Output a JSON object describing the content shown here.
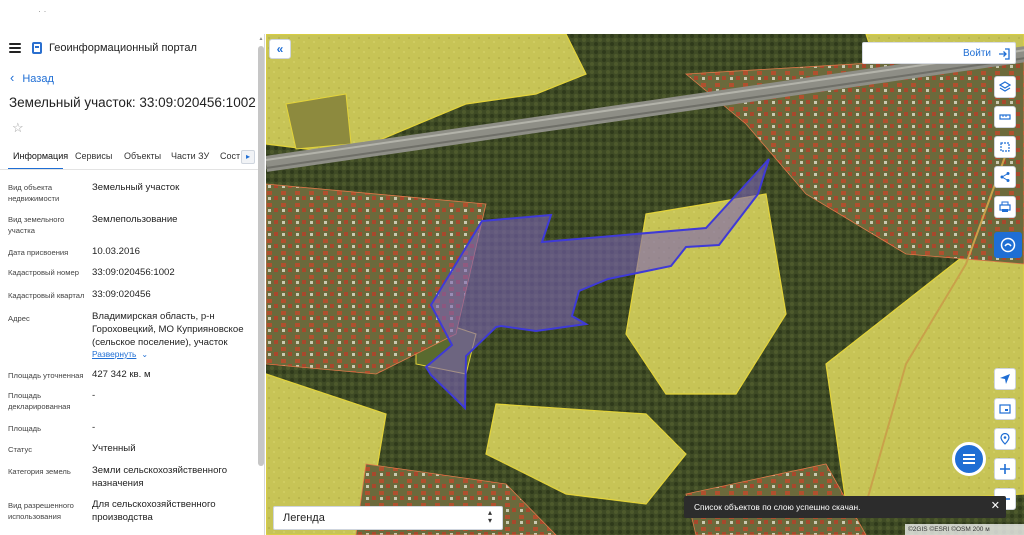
{
  "header": {
    "portal_title": "Геоинформационный портал"
  },
  "nav": {
    "back_label": "Назад"
  },
  "parcel": {
    "title": "Земельный участок: 33:09:020456:1002"
  },
  "tabs": [
    {
      "label": "Информация"
    },
    {
      "label": "Сервисы"
    },
    {
      "label": "Объекты"
    },
    {
      "label": "Части ЗУ"
    },
    {
      "label": "Сост"
    }
  ],
  "fields": [
    {
      "label": "Вид объекта недвижимости",
      "value": "Земельный участок"
    },
    {
      "label": "Вид земельного участка",
      "value": "Землепользование"
    },
    {
      "label": "Дата присвоения",
      "value": "10.03.2016"
    },
    {
      "label": "Кадастровый номер",
      "value": "33:09:020456:1002"
    },
    {
      "label": "Кадастровый квартал",
      "value": "33:09:020456"
    },
    {
      "label": "Адрес",
      "value": "Владимирская область, р-н Гороховецкий, МО Куприяновское (сельское поселение), участок"
    },
    {
      "label": "Площадь уточненная",
      "value": "427 342 кв. м"
    },
    {
      "label": "Площадь декларированная",
      "value": "-"
    },
    {
      "label": "Площадь",
      "value": "-"
    },
    {
      "label": "Статус",
      "value": "Учтенный"
    },
    {
      "label": "Категория земель",
      "value": "Земли сельскохозяйственного назначения"
    },
    {
      "label": "Вид разрешенного использования",
      "value": "Для сельскохозяйственного производства"
    }
  ],
  "address_expand_label": "Развернуть",
  "map": {
    "login_label": "Войти",
    "legend_label": "Легенда",
    "toast_message": "Список объектов по слою успешно скачан.",
    "attribution": "©2GIS ©ESRI ©OSM  200 м",
    "colors": {
      "parcel_fill": "#7a63b8",
      "parcel_stroke": "#3f3ad6",
      "accent": "#1f6ed4"
    }
  },
  "icons": [
    "menu-icon",
    "portal-logo-icon",
    "chevron-left-icon",
    "star-icon",
    "chevron-right-icon",
    "double-chevron-left-icon",
    "login-icon",
    "layers-icon",
    "ruler-icon",
    "select-area-icon",
    "share-icon",
    "print-icon",
    "assistant-icon",
    "locate-icon",
    "screen-icon",
    "pin-icon",
    "zoom-in-icon",
    "zoom-out-icon",
    "chat-icon",
    "close-icon"
  ]
}
